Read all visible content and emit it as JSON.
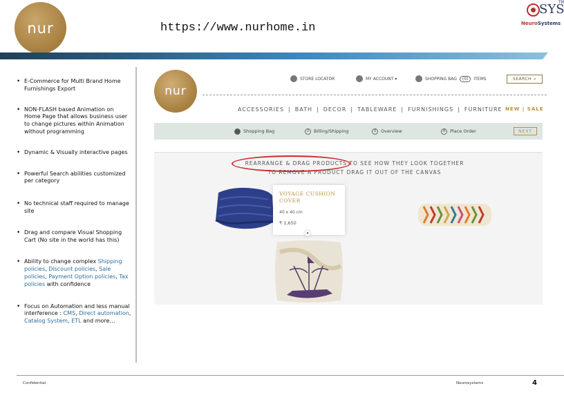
{
  "header": {
    "logo_text": "nur",
    "url": "https://www.nurhome.in",
    "brand_sys": "SYS",
    "brand_tm": "TM",
    "brand_sub_a": "Neuro",
    "brand_sub_b": "Systems"
  },
  "bullets": [
    {
      "text": "E-Commerce for Multi Brand Home Furnishings Export"
    },
    {
      "text": "NON-FLASH based Animation on Home Page that allows business user to change pictures within Animation without programming"
    },
    {
      "text": "Dynamic & Visually interactive pages"
    },
    {
      "text": "Powerful Search abilities customized per category"
    },
    {
      "text": "No technical staff required to manage site"
    },
    {
      "text": "Drag and compare Visual Shopping Cart (No site in the world has this)"
    }
  ],
  "bullet7": {
    "prefix": "Ability to change complex ",
    "l1": "Shipping policies",
    "s1": ", ",
    "l2": "Discount policies",
    "s2": ", ",
    "l3": "Sale policies",
    "s3": ", ",
    "l4": "Payment Option policies",
    "s4": ", ",
    "l5": "Tax policies",
    "suffix": " with confidence"
  },
  "bullet8": {
    "prefix": "Focus on Automation and less manual interference : ",
    "l1": "CMS",
    "s1": ", ",
    "l2": "Direct automation",
    "s2": ", ",
    "l3": "Catalog System",
    "s3": ", ",
    "l4": "ETL",
    "suffix": " and more…"
  },
  "site": {
    "logo_text": "nur",
    "store_locator": "STORE LOCATOR",
    "my_account": "MY ACCOUNT ▾",
    "shopping_bag": "SHOPPING BAG",
    "bag_count": "(0)",
    "items": "ITEMS",
    "search_label": "SEARCH",
    "categories": [
      "ACCESSORIES",
      "|",
      "BATH",
      "|",
      "DECOR",
      "|",
      "TABLEWARE",
      "|",
      "FURNISHINGS",
      "|",
      "FURNITURE"
    ],
    "new_sale": "NEW | SALE",
    "steps": [
      {
        "label": "Shopping Bag",
        "num": ""
      },
      {
        "label": "Billing/Shipping",
        "num": "2"
      },
      {
        "label": "Overview",
        "num": "3"
      },
      {
        "label": "Place Order",
        "num": "4"
      }
    ],
    "next_label": "NEXT",
    "instr_line1": "REARRANGE & DRAG PRODUCTS TO SEE HOW THEY LOOK TOGETHER",
    "instr_line2": "TO REMOVE A PRODUCT DRAG IT OUT OF THE CANVAS",
    "product_name": "VOYAGE CUSHION COVER",
    "product_size": "40 x 40 cm",
    "product_price": "₹ 1,650"
  },
  "footer": {
    "left": "Confidential",
    "mid": "Neurosystems",
    "page": "4"
  }
}
